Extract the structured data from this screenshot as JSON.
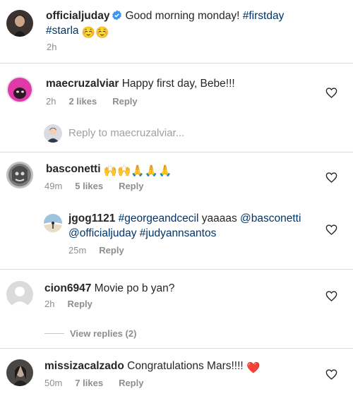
{
  "caption": {
    "username": "officialjuday",
    "text": "Good morning monday!",
    "tag1": "#firstday",
    "tag2": "#starla",
    "emoji": "☺️☺️",
    "time": "2h"
  },
  "comments": [
    {
      "username": "maecruzalviar",
      "text": "Happy first day, Bebe!!!",
      "time": "2h",
      "likes": "2 likes",
      "reply": "Reply"
    },
    {
      "username": "basconetti",
      "text": "🙌🙌🙏🙏🙏",
      "time": "49m",
      "likes": "5 likes",
      "reply": "Reply"
    },
    {
      "username": "cion6947",
      "text": "Movie po b yan?",
      "time": "2h",
      "reply": "Reply"
    },
    {
      "username": "missizacalzado",
      "text": "Congratulations Mars!!!!",
      "emoji": "❤️",
      "time": "50m",
      "likes": "7 likes",
      "reply": "Reply"
    }
  ],
  "reply_box": {
    "placeholder": "Reply to maecruzalviar..."
  },
  "nested_reply": {
    "username": "jgog1121",
    "tag1": "#georgeandcecil",
    "text_mid": "yaaaas",
    "mention1": "@basconetti",
    "mention2": "@officialjuday",
    "tag2": "#judyannsantos",
    "time": "25m",
    "reply": "Reply"
  },
  "view_replies": "View replies (2)",
  "colors": {
    "link": "#003569",
    "muted": "#8e8e8e",
    "verified": "#3897f0",
    "heart_red": "#e0245e"
  }
}
